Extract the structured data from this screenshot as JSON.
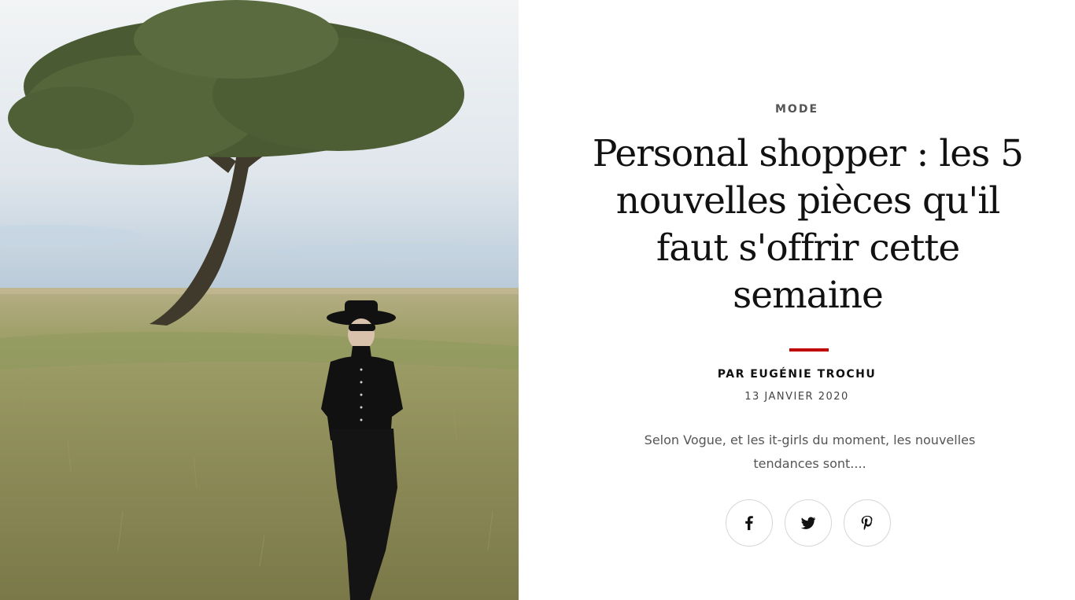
{
  "hero": {
    "image_description": "hero-photo"
  },
  "article": {
    "category": "MODE",
    "title": "Personal shopper : les 5 nouvelles pièces qu'il faut s'offrir cette semaine",
    "byline": "PAR EUGÉNIE TROCHU",
    "date": "13 JANVIER 2020",
    "excerpt": "Selon Vogue, et les it-girls du moment, les nouvelles tendances sont...."
  },
  "colors": {
    "accent": "#c00000",
    "text": "#111111",
    "muted": "#555555"
  },
  "share": {
    "buttons": [
      {
        "icon": "facebook-icon"
      },
      {
        "icon": "twitter-icon"
      },
      {
        "icon": "pinterest-icon"
      }
    ]
  }
}
